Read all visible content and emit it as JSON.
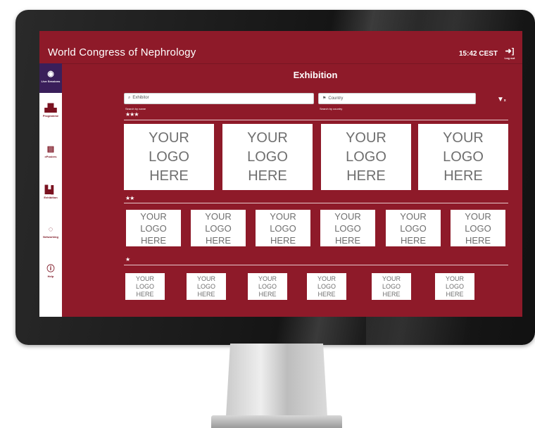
{
  "app": {
    "title": "World Congress of Nephrology",
    "time": "15:42 CEST",
    "logout_label": "Log out"
  },
  "sidebar": {
    "items": [
      {
        "label": "Live Sessions",
        "icon": "live-sessions-icon"
      },
      {
        "label": "Programme",
        "icon": "programme-icon"
      },
      {
        "label": "ePosters",
        "icon": "eposters-icon"
      },
      {
        "label": "Exhibition",
        "icon": "exhibition-icon"
      },
      {
        "label": "Networking",
        "icon": "networking-icon"
      },
      {
        "label": "Help",
        "icon": "help-icon"
      }
    ]
  },
  "page": {
    "title": "Exhibition"
  },
  "search": {
    "exhibitor_placeholder": "Exhibitor",
    "exhibitor_hint": "Search by name",
    "country_placeholder": "Country",
    "country_hint": "Search by country"
  },
  "filter": {
    "icon": "filter-clear-icon"
  },
  "tiers": [
    {
      "stars": "★★★",
      "logo_text": [
        "YOUR",
        "LOGO",
        "HERE"
      ],
      "count": 4
    },
    {
      "stars": "★★",
      "logo_text": [
        "YOUR",
        "LOGO",
        "HERE"
      ],
      "count": 6
    },
    {
      "stars": "★",
      "logo_text": [
        "YOUR",
        "LOGO",
        "HERE"
      ],
      "count": 6
    }
  ],
  "colors": {
    "brand": "#8e1a29",
    "sidebar_active": "#3a1f5a",
    "white": "#ffffff"
  }
}
